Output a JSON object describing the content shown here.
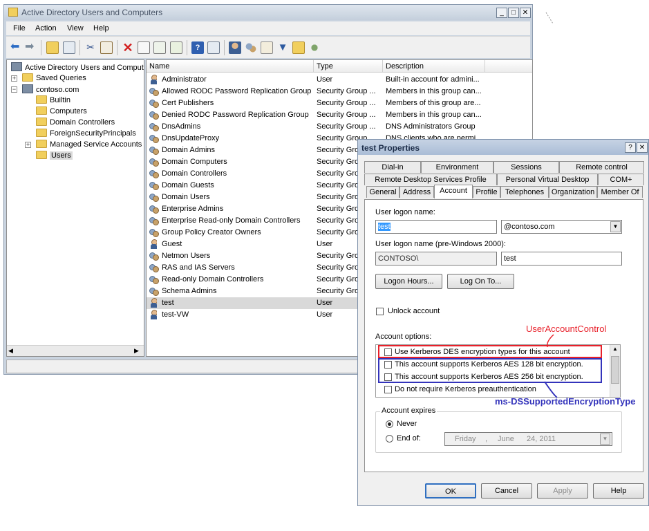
{
  "main": {
    "title": "Active Directory Users and Computers",
    "window_buttons": [
      "_",
      "□",
      "✕"
    ],
    "menu": [
      "File",
      "Action",
      "View",
      "Help"
    ],
    "tree": {
      "root": "Active Directory Users and Comput",
      "saved_queries": "Saved Queries",
      "domain": "contoso.com",
      "children": [
        "Builtin",
        "Computers",
        "Domain Controllers",
        "ForeignSecurityPrincipals",
        "Managed Service Accounts",
        "Users"
      ]
    },
    "columns": [
      "Name",
      "Type",
      "Description"
    ],
    "rows": [
      {
        "name": "Administrator",
        "type": "User",
        "desc": "Built-in account for admini...",
        "icon": "user"
      },
      {
        "name": "Allowed RODC Password Replication Group",
        "type": "Security Group ...",
        "desc": "Members in this group can...",
        "icon": "group"
      },
      {
        "name": "Cert Publishers",
        "type": "Security Group ...",
        "desc": "Members of this group are...",
        "icon": "group"
      },
      {
        "name": "Denied RODC Password Replication Group",
        "type": "Security Group ...",
        "desc": "Members in this group can...",
        "icon": "group"
      },
      {
        "name": "DnsAdmins",
        "type": "Security Group ...",
        "desc": "DNS Administrators Group",
        "icon": "group"
      },
      {
        "name": "DnsUpdateProxy",
        "type": "Security Group ...",
        "desc": "DNS clients who are permi...",
        "icon": "group"
      },
      {
        "name": "Domain Admins",
        "type": "Security Grou",
        "desc": "",
        "icon": "group"
      },
      {
        "name": "Domain Computers",
        "type": "Security Grou",
        "desc": "",
        "icon": "group"
      },
      {
        "name": "Domain Controllers",
        "type": "Security Grou",
        "desc": "",
        "icon": "group"
      },
      {
        "name": "Domain Guests",
        "type": "Security Grou",
        "desc": "",
        "icon": "group"
      },
      {
        "name": "Domain Users",
        "type": "Security Grou",
        "desc": "",
        "icon": "group"
      },
      {
        "name": "Enterprise Admins",
        "type": "Security Grou",
        "desc": "",
        "icon": "group"
      },
      {
        "name": "Enterprise Read-only Domain Controllers",
        "type": "Security Grou",
        "desc": "",
        "icon": "group"
      },
      {
        "name": "Group Policy Creator Owners",
        "type": "Security Grou",
        "desc": "",
        "icon": "group"
      },
      {
        "name": "Guest",
        "type": "User",
        "desc": "",
        "icon": "user"
      },
      {
        "name": "Netmon Users",
        "type": "Security Grou",
        "desc": "",
        "icon": "group"
      },
      {
        "name": "RAS and IAS Servers",
        "type": "Security Grou",
        "desc": "",
        "icon": "group"
      },
      {
        "name": "Read-only Domain Controllers",
        "type": "Security Grou",
        "desc": "",
        "icon": "group"
      },
      {
        "name": "Schema Admins",
        "type": "Security Grou",
        "desc": "",
        "icon": "group"
      },
      {
        "name": "test",
        "type": "User",
        "desc": "",
        "icon": "user"
      },
      {
        "name": "test-VW",
        "type": "User",
        "desc": "",
        "icon": "user"
      }
    ]
  },
  "dialog": {
    "title": "test Properties",
    "title_buttons": [
      "?",
      "✕"
    ],
    "tabs_row1": [
      "Dial-in",
      "Environment",
      "Sessions",
      "Remote control"
    ],
    "tabs_row2": [
      "Remote Desktop Services Profile",
      "Personal Virtual Desktop",
      "COM+"
    ],
    "tabs_row3": [
      "General",
      "Address",
      "Account",
      "Profile",
      "Telephones",
      "Organization",
      "Member Of"
    ],
    "logon_label": "User logon name:",
    "logon_value": "test",
    "domain_value": "@contoso.com",
    "pre2000_label": "User logon name (pre-Windows 2000):",
    "pre2000_domain": "CONTOSO\\",
    "pre2000_value": "test",
    "logon_hours": "Logon Hours...",
    "log_on_to": "Log On To...",
    "unlock": "Unlock account",
    "options_label": "Account options:",
    "options": [
      "Use Kerberos DES encryption types for this account",
      "This account supports Kerberos AES 128 bit encryption.",
      "This account supports Kerberos AES 256 bit encryption.",
      "Do not require Kerberos preauthentication"
    ],
    "expires_label": "Account expires",
    "never": "Never",
    "end_of": "End of:",
    "date": {
      "day": "Friday",
      "sep1": ",",
      "month": "June",
      "daynum": "24, 2011"
    },
    "ok": "OK",
    "cancel": "Cancel",
    "apply": "Apply",
    "help": "Help"
  },
  "annotations": {
    "uac": "UserAccountControl",
    "enc": "ms-DSSupportedEncryptionType",
    "uac_color": "#e8202a",
    "enc_color": "#3333bb"
  }
}
